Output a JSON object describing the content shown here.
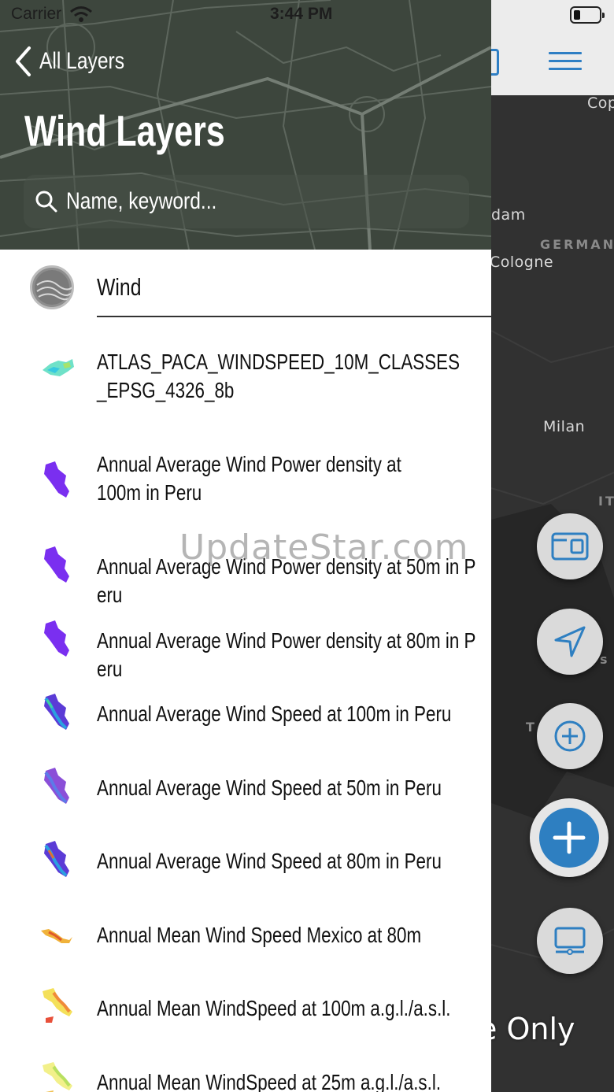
{
  "status_bar": {
    "carrier": "Carrier",
    "time": "3:44 PM"
  },
  "header": {
    "back_label": "All Layers",
    "title": "Wind Layers",
    "search_placeholder": "Name, keyword..."
  },
  "category": {
    "label": "Wind"
  },
  "layers": [
    {
      "label": "ATLAS_PACA_WINDSPEED_10M_CLASSES_EPSG_4326_8b",
      "thumb": "paca-map-thumb"
    },
    {
      "label": "Annual Average Wind Power density at 100m in Peru",
      "thumb": "peru-purple-thumb"
    },
    {
      "label": "Annual Average Wind Power density at 50m in Peru",
      "thumb": "peru-purple-thumb"
    },
    {
      "label": "Annual Average Wind Power density at 80m in Peru",
      "thumb": "peru-purple-thumb"
    },
    {
      "label": "Annual Average Wind Speed at 100m in Peru",
      "thumb": "peru-multicolor-thumb"
    },
    {
      "label": "Annual Average Wind Speed at 50m in Peru",
      "thumb": "peru-multicolor-thumb"
    },
    {
      "label": "Annual Average Wind Speed at 80m in Peru",
      "thumb": "peru-multicolor-thumb"
    },
    {
      "label": "Annual Mean Wind Speed Mexico at 80m",
      "thumb": "mexico-thumb"
    },
    {
      "label": "Annual Mean WindSpeed at 100m a.g.l./a.s.l.",
      "thumb": "italy-thumb"
    },
    {
      "label": "Annual Mean WindSpeed at 25m a.g.l./a.s.l.",
      "thumb": "italy-thumb"
    }
  ],
  "map": {
    "labels": {
      "copenhagen": "Cop",
      "amsterdam": "dam",
      "germany": "GERMAN",
      "cologne": "Cologne",
      "milan": "Milan",
      "italy": "IT",
      "t": "T",
      "s": "s"
    },
    "watermark_right": "e Only"
  },
  "watermark": "UpdateStar.com",
  "colors": {
    "accent": "#2e7fc1",
    "header_bg": "#3d463d",
    "map_bg": "#313131"
  }
}
